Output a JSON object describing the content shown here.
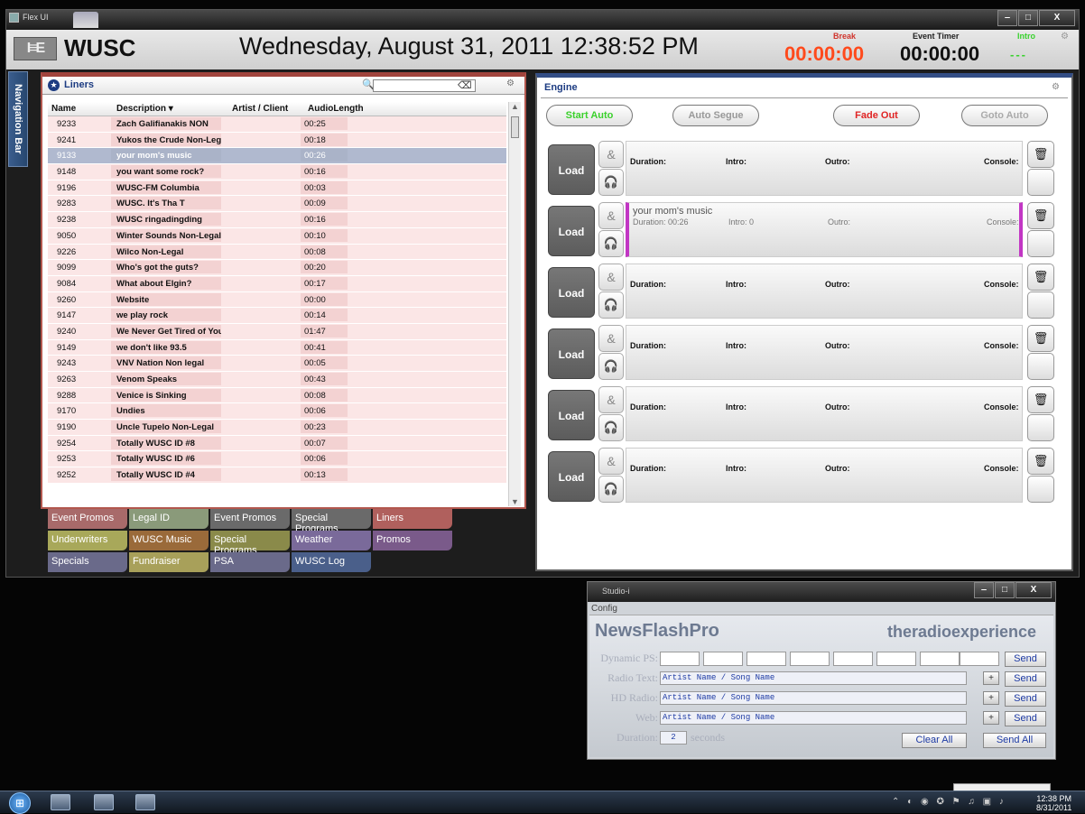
{
  "window": {
    "title": "Flex UI",
    "min": "‒",
    "max": "□",
    "close": "X"
  },
  "header": {
    "logo": "I≡E",
    "station": "WUSC",
    "datetime": "Wednesday, August 31, 2011 12:38:52 PM",
    "break_label": "Break",
    "event_timer_label": "Event Timer",
    "intro_label": "Intro",
    "break_time": "00:00:00",
    "event_time": "00:00:00",
    "intro_time": "---",
    "gear": "⚙"
  },
  "nav": {
    "label": "Navigation Bar"
  },
  "liners": {
    "title": "Liners",
    "star": "★",
    "search_icon": "🔍",
    "search_value": "",
    "clear": "⌫",
    "gear": "⚙",
    "columns": [
      "Name",
      "Description ▾",
      "Artist / Client",
      "AudioLength"
    ],
    "rows": [
      {
        "name": "9233",
        "desc": "Zach Galifianakis NON",
        "len": "00:25"
      },
      {
        "name": "9241",
        "desc": "Yukos the Crude Non-Legal",
        "len": "00:18"
      },
      {
        "name": "9133",
        "desc": "your mom's music",
        "len": "00:26"
      },
      {
        "name": "9148",
        "desc": "you want some rock?",
        "len": "00:16"
      },
      {
        "name": "9196",
        "desc": "WUSC-FM Columbia",
        "len": "00:03"
      },
      {
        "name": "9283",
        "desc": "WUSC. It's Tha T",
        "len": "00:09"
      },
      {
        "name": "9238",
        "desc": "WUSC ringadingding",
        "len": "00:16"
      },
      {
        "name": "9050",
        "desc": "Winter Sounds Non-Legal",
        "len": "00:10"
      },
      {
        "name": "9226",
        "desc": "Wilco Non-Legal",
        "len": "00:08"
      },
      {
        "name": "9099",
        "desc": "Who's got the guts?",
        "len": "00:20"
      },
      {
        "name": "9084",
        "desc": "What about Elgin?",
        "len": "00:17"
      },
      {
        "name": "9260",
        "desc": "Website",
        "len": "00:00"
      },
      {
        "name": "9147",
        "desc": "we play rock",
        "len": "00:14"
      },
      {
        "name": "9240",
        "desc": "We Never Get Tired of Your",
        "len": "01:47"
      },
      {
        "name": "9149",
        "desc": "we don't like 93.5",
        "len": "00:41"
      },
      {
        "name": "9243",
        "desc": "VNV Nation Non legal",
        "len": "00:05"
      },
      {
        "name": "9263",
        "desc": "Venom Speaks",
        "len": "00:43"
      },
      {
        "name": "9288",
        "desc": "Venice is Sinking",
        "len": "00:08"
      },
      {
        "name": "9170",
        "desc": "Undies",
        "len": "00:06"
      },
      {
        "name": "9190",
        "desc": "Uncle Tupelo Non-Legal",
        "len": "00:23"
      },
      {
        "name": "9254",
        "desc": "Totally WUSC ID #8",
        "len": "00:07"
      },
      {
        "name": "9253",
        "desc": "Totally WUSC ID #6",
        "len": "00:06"
      },
      {
        "name": "9252",
        "desc": "Totally WUSC ID #4",
        "len": "00:13"
      }
    ],
    "selected_name": "9133",
    "scroll_up": "▲",
    "scroll_down": "▼"
  },
  "categories": [
    {
      "label": "Event Promos",
      "color": "#a86a6a"
    },
    {
      "label": "Legal ID",
      "color": "#8a9a7a"
    },
    {
      "label": "Event Promos",
      "color": "#6a6a6a"
    },
    {
      "label": "Special Programs",
      "color": "#6a6a6a"
    },
    {
      "label": "Liners",
      "color": "#b0605d"
    },
    {
      "label": "Underwriters",
      "color": "#a8a85a"
    },
    {
      "label": "WUSC Music",
      "color": "#9a6a3a"
    },
    {
      "label": "Special Programs",
      "color": "#8a8a4a"
    },
    {
      "label": "Weather",
      "color": "#7a6a9a"
    },
    {
      "label": "Promos",
      "color": "#7a5a8a"
    },
    {
      "label": "Specials",
      "color": "#6a6a8a"
    },
    {
      "label": "Fundraiser",
      "color": "#a8a05a"
    },
    {
      "label": "PSA",
      "color": "#6a6a8a"
    },
    {
      "label": "WUSC Log",
      "color": "#4a5f8a"
    }
  ],
  "engine": {
    "title": "Engine",
    "gear": "⚙",
    "controls": [
      {
        "label": "Start Auto",
        "color": "#3bd12c"
      },
      {
        "label": "Auto Segue",
        "color": "#999999"
      },
      {
        "label": "Fade Out",
        "color": "#e02424"
      },
      {
        "label": "Goto Auto",
        "color": "#aaaaaa"
      }
    ],
    "load": "Load",
    "amp": "&",
    "headphones": "🎧",
    "trash": "🗑",
    "duration": "Duration:",
    "intro": "Intro:",
    "outro": "Outro:",
    "console": "Console:",
    "loaded": {
      "title": "your mom's music",
      "duration": "Duration: 00:26",
      "intro": "Intro: 0",
      "outro": "Outro:",
      "console": "Console:"
    }
  },
  "studio": {
    "title": "Studio-i",
    "menu": "Config",
    "brand_left": "NewsFlashPro",
    "brand_right": "theradioexperience",
    "dynamic_ps_label": "Dynamic PS:",
    "radio_text_label": "Radio Text:",
    "hd_radio_label": "HD Radio:",
    "web_label": "Web:",
    "duration_label": "Duration:",
    "radio_text_value": "Artist Name / Song Name",
    "hd_radio_value": "Artist Name / Song Name",
    "web_value": "Artist Name / Song Name",
    "duration_value": "2",
    "seconds": "seconds",
    "send": "Send",
    "plus": "+",
    "clear_all": "Clear All",
    "send_all": "Send All"
  },
  "taskbar": {
    "start": "⊞",
    "tray": "⌃ ◐ ◉ ✪ ⚑ ♫ ▣ ♪",
    "time": "12:38 PM",
    "date": "8/31/2011"
  }
}
